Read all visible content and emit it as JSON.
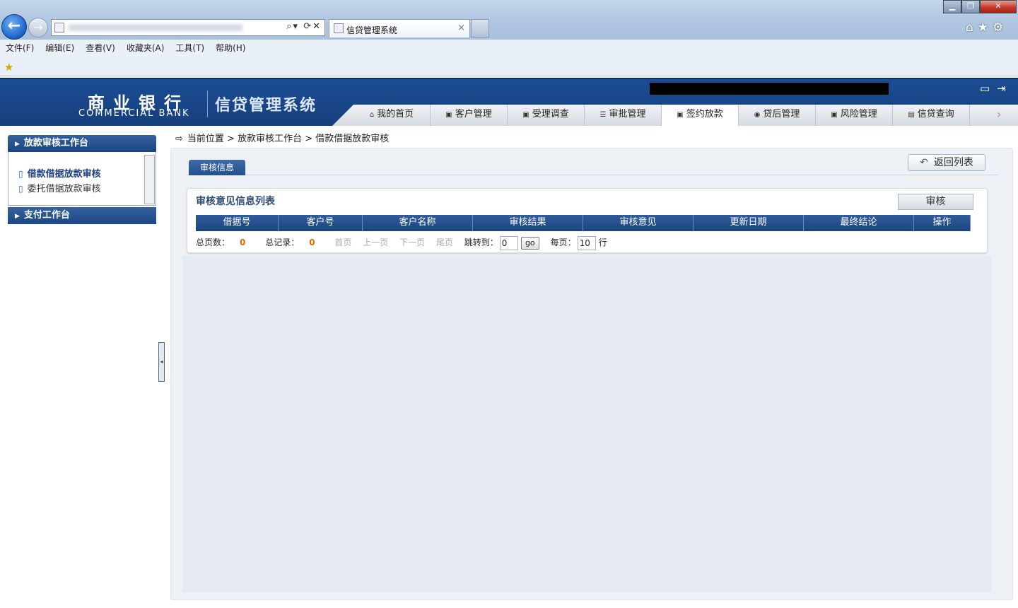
{
  "browser": {
    "tab_title": "信贷管理系统",
    "tab_close": "×",
    "address_tools": "⌕▾ ⟳✕",
    "back_glyph": "←",
    "forward_glyph": "→",
    "window_min": "▁",
    "window_max": "❐",
    "window_close": "✕",
    "right_icons": "⌂★⚙",
    "menu": [
      "文件(F)",
      "编辑(E)",
      "查看(V)",
      "收藏夹(A)",
      "工具(T)",
      "帮助(H)"
    ],
    "favorites_glyph": "★"
  },
  "header": {
    "logo_cn": "商业银行",
    "logo_en": "COMMERCIAL BANK",
    "system_name": "信贷管理系统",
    "top_icons": "▭⇥",
    "nav": [
      {
        "label": "我的首页",
        "icon": "⌂"
      },
      {
        "label": "客户管理",
        "icon": "▣"
      },
      {
        "label": "受理调查",
        "icon": "▣"
      },
      {
        "label": "审批管理",
        "icon": "☰"
      },
      {
        "label": "签约放款",
        "icon": "▣"
      },
      {
        "label": "贷后管理",
        "icon": "◉"
      },
      {
        "label": "风险管理",
        "icon": "▣"
      },
      {
        "label": "信贷查询",
        "icon": "▤"
      }
    ],
    "nav_active": "签约放款",
    "nav_more": "›"
  },
  "sidebar": {
    "section1": "放款审核工作台",
    "items": [
      "借款借据放款审核",
      "委托借据放款审核"
    ],
    "active_item": "借款借据放款审核",
    "section2": "支付工作台",
    "collapse_glyph": "◂"
  },
  "main": {
    "breadcrumb": "当前位置 > 放款审核工作台 > 借款借据放款审核",
    "tab_label": "审核信息",
    "back_button": "返回列表",
    "back_icon": "↶",
    "panel_title": "审核意见信息列表",
    "audit_button": "审核",
    "columns": [
      "借据号",
      "客户号",
      "客户名称",
      "审核结果",
      "审核意见",
      "更新日期",
      "最终结论",
      "操作"
    ],
    "rows": [],
    "pager": {
      "total_pages_label": "总页数：",
      "total_pages": "0",
      "total_records_label": "总记录：",
      "total_records": "0",
      "first": "首页",
      "prev": "上一页",
      "next": "下一页",
      "last": "尾页",
      "jump_label": "跳转到：",
      "jump_value": "0",
      "go": "go",
      "per_page_label": "每页：",
      "per_page_value": "10",
      "per_page_unit": "行"
    }
  },
  "colors": {
    "header_blue": "#1b4d94",
    "table_head": "#2f5c9c",
    "accent_orange": "#d07000"
  }
}
